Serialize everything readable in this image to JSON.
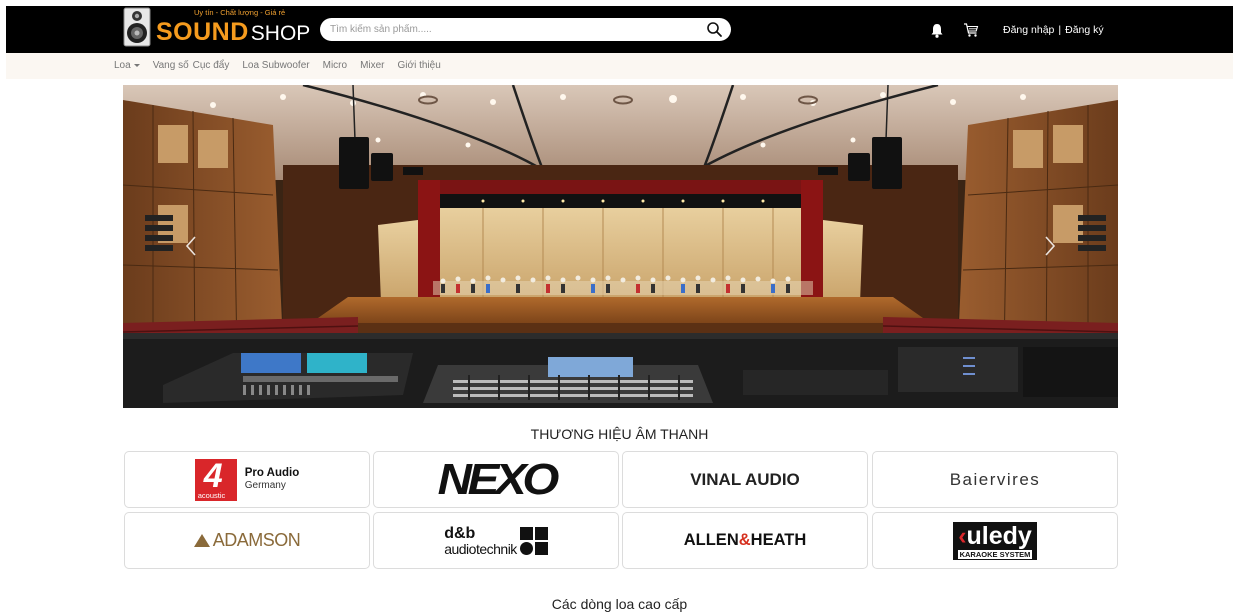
{
  "header": {
    "tagline": "Uy tín - Chất lượng - Giá rẻ",
    "logo_part1": "SOUND",
    "logo_part2": "SHOP",
    "search_placeholder": "Tìm kiếm sản phẩm.....",
    "login_label": "Đăng nhập",
    "separator": "|",
    "register_label": "Đăng ký"
  },
  "nav": {
    "items": [
      "Loa",
      "Vang số",
      "Cục đẩy",
      "Loa Subwoofer",
      "Micro",
      "Mixer",
      "Giới thiệu"
    ]
  },
  "brands": {
    "title": "THƯƠNG HIỆU ÂM THANH",
    "items": [
      {
        "name": "4 acoustic Pro Audio Germany",
        "line1": "Pro Audio",
        "line2": "Germany",
        "sub": "acoustic"
      },
      {
        "name": "NEXO",
        "text": "NEXO"
      },
      {
        "name": "VINAL AUDIO",
        "text": "VINAL AUDIO"
      },
      {
        "name": "Baiervires",
        "text": "Baiervires"
      },
      {
        "name": "ADAMSON",
        "text": "ADAMSON"
      },
      {
        "name": "d&b audiotechnik",
        "line1": "d&b",
        "line2": "audiotechnik"
      },
      {
        "name": "ALLEN&HEATH",
        "part1": "ALLEN",
        "part2": "&",
        "part3": "HEATH"
      },
      {
        "name": "Kuledy Karaoke System",
        "text": "uledy",
        "sub": "KARAOKE SYSTEM"
      }
    ]
  },
  "section2": {
    "title": "Các dòng loa cao cấp"
  },
  "colors": {
    "brand_orange": "#f59b1e",
    "header_bg": "#000000",
    "nav_bg": "#fbf7f2",
    "allen_red": "#d6301f",
    "acoustic_red": "#d9262a"
  },
  "icons": [
    "speaker-logo-icon",
    "search-icon",
    "bell-icon",
    "cart-icon",
    "chevron-left-icon",
    "chevron-right-icon"
  ]
}
